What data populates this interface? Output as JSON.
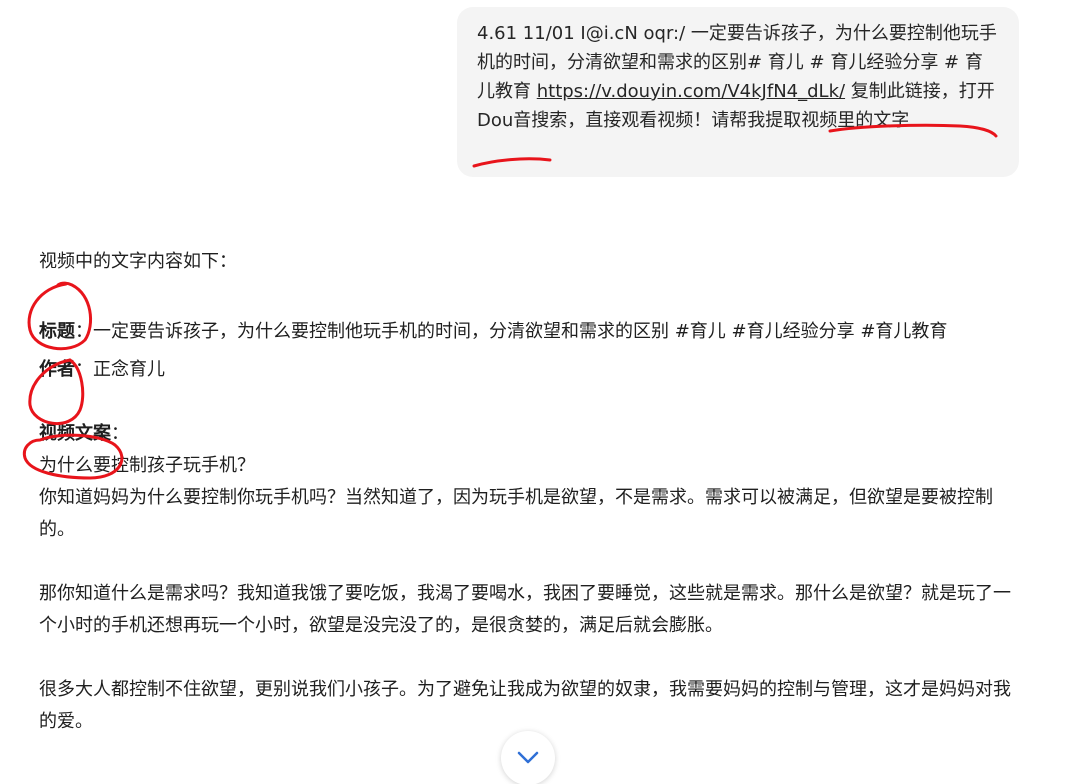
{
  "user_message": {
    "text_before": "4.61 11/01 I@i.cN oqr:/ 一定要告诉孩子，为什么要控制他玩手机的时间，分清欲望和需求的区别# 育儿 # 育儿经验分享 # 育儿教育 ",
    "link": "https://v.douyin.com/V4kJfN4_dLk/",
    "text_after": " 复制此链接，打开Dou音搜索，直接观看视频！",
    "request": "请帮我提取视频里的文字"
  },
  "assistant": {
    "intro": "视频中的文字内容如下：",
    "title_label": "标题",
    "title_value": "：一定要告诉孩子，为什么要控制他玩手机的时间，分清欲望和需求的区别 #育儿 #育儿经验分享 #育儿教育",
    "author_label": "作者",
    "author_value": "：正念育儿",
    "script_label": "视频文案",
    "script_colon": "：",
    "lines": [
      "为什么要控制孩子玩手机？",
      "你知道妈妈为什么要控制你玩手机吗？当然知道了，因为玩手机是欲望，不是需求。需求可以被满足，但欲望是要被控制的。"
    ],
    "paragraphs": [
      "那你知道什么是需求吗？我知道我饿了要吃饭，我渴了要喝水，我困了要睡觉，这些就是需求。那什么是欲望？就是玩了一个小时的手机还想再玩一个小时，欲望是没完没了的，是很贪婪的，满足后就会膨胀。",
      "很多大人都控制不住欲望，更别说我们小孩子。为了避免让我成为欲望的奴隶，我需要妈妈的控制与管理，这才是妈妈对我的爱。"
    ]
  },
  "icons": {
    "scroll_down": "chevron-down-icon"
  },
  "colors": {
    "bubble_bg": "#f4f4f4",
    "annotation": "#e8141b",
    "scroll_chevron": "#2f6fd6"
  }
}
